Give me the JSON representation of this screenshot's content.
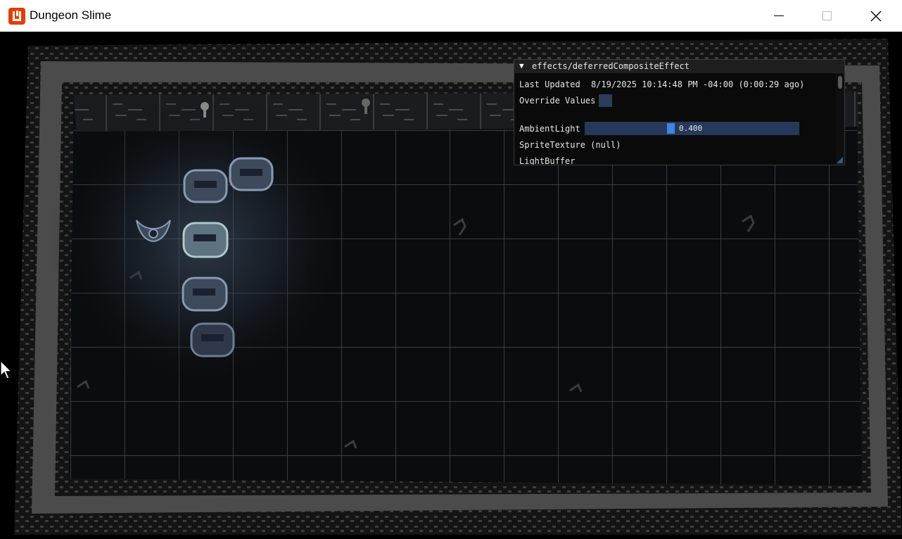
{
  "window": {
    "title": "Dungeon Slime",
    "icon": "monogame-logo-icon",
    "controls": [
      "minimize",
      "maximize",
      "close"
    ]
  },
  "debug_panel": {
    "title": "effects/deferredCompositeEffect",
    "last_updated_label": "Last Updated",
    "last_updated_value": "8/19/2025 10:14:48 PM -04:00 (0:00:29 ago)",
    "override_label": "Override Values",
    "ambient_label": "AmbientLight",
    "ambient_value_text": "0.400",
    "ambient_value": 0.4,
    "sprite_label": "SpriteTexture (null)",
    "light_label": "LightBuffer"
  },
  "game": {
    "scene": "dungeon-room",
    "entities": [
      "slime-segment",
      "slime-segment",
      "slime-segment",
      "slime-segment",
      "slime-segment",
      "bat"
    ]
  },
  "colors": {
    "accent": "#3d85e0",
    "slider_bg": "#26395a",
    "override_box": "#2a3d5a"
  }
}
